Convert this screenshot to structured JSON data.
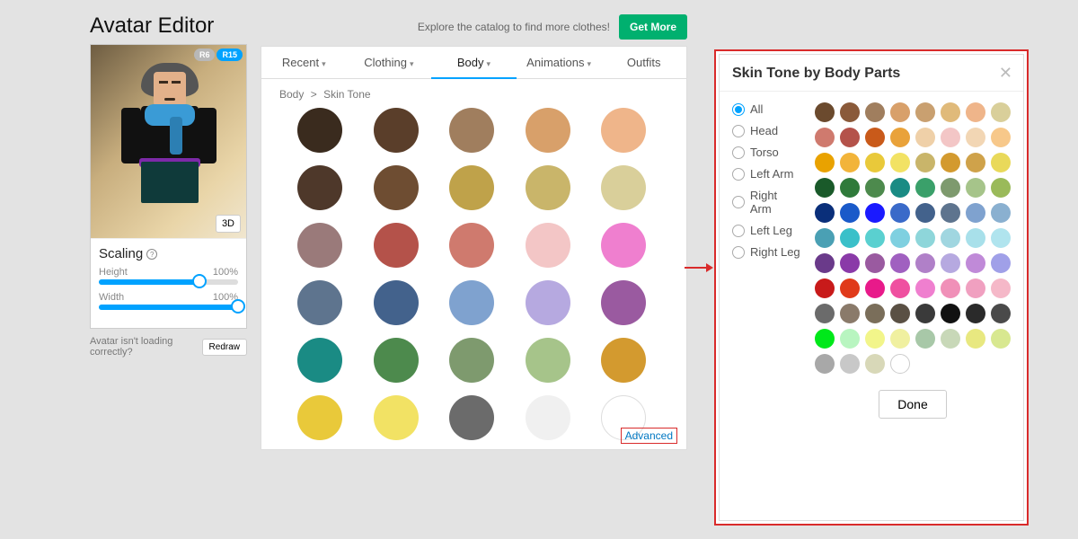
{
  "title": "Avatar Editor",
  "badges": {
    "r6": "R6",
    "r15": "R15"
  },
  "btn_3d": "3D",
  "scaling": {
    "title": "Scaling",
    "height_label": "Height",
    "height_value": "100%",
    "height_pct": 72,
    "width_label": "Width",
    "width_value": "100%",
    "width_pct": 100
  },
  "loading_prompt": "Avatar isn't loading correctly?",
  "redraw_label": "Redraw",
  "promo_text": "Explore the catalog to find more clothes!",
  "get_more_label": "Get More",
  "tabs": {
    "recent": "Recent",
    "clothing": "Clothing",
    "body": "Body",
    "animations": "Animations",
    "outfits": "Outfits"
  },
  "breadcrumb": {
    "a": "Body",
    "sep": ">",
    "b": "Skin Tone"
  },
  "main_swatches": [
    "#3a2b1e",
    "#5a3e2a",
    "#a07e5e",
    "#d8a06a",
    "#efb58a",
    "#4e382a",
    "#6e4d32",
    "#bfa24a",
    "#c9b56a",
    "#d9cf9a",
    "#9a7a7a",
    "#b4524a",
    "#cf7a6e",
    "#f3c6c6",
    "#ef7fcf",
    "#5e748e",
    "#43628c",
    "#7fa2cf",
    "#b6a9e0",
    "#9a5aa0",
    "#1a8b84",
    "#4d8a4d",
    "#7e9a6e",
    "#a6c48a",
    "#d39a2f",
    "#e9c93a",
    "#f2e264",
    "#6b6b6b",
    "#f0f0f0",
    "#ffffff"
  ],
  "advanced_label": "Advanced",
  "dialog": {
    "title": "Skin Tone by Body Parts",
    "parts": [
      "All",
      "Head",
      "Torso",
      "Left Arm",
      "Right Arm",
      "Left Leg",
      "Right Leg"
    ],
    "selected": "All",
    "done_label": "Done",
    "swatches": [
      "#6b4a2e",
      "#8a5a3a",
      "#a07e5e",
      "#d8a06a",
      "#c9a070",
      "#e0ba7a",
      "#efb58a",
      "#d9cf9a",
      "#cf7a6e",
      "#b4524a",
      "#c95a1a",
      "#e9a23a",
      "#efd0a8",
      "#f3c6c6",
      "#f2d6b4",
      "#f7c88a",
      "#e9a200",
      "#f2b43a",
      "#e9c93a",
      "#f2e264",
      "#c9b56a",
      "#d39a2f",
      "#cfa24a",
      "#e9d95a",
      "#1a5a2a",
      "#2f7a3a",
      "#4d8a4d",
      "#1a8b84",
      "#3aa06a",
      "#7e9a6e",
      "#a6c48a",
      "#9aba5a",
      "#0a2f7a",
      "#1a5ac9",
      "#1a1aff",
      "#3a6ac9",
      "#43628c",
      "#5e748e",
      "#7fa2cf",
      "#8ab0d0",
      "#4aa0b4",
      "#3ac0c9",
      "#5ad0d0",
      "#7fd0e0",
      "#8ed6da",
      "#a0d6e0",
      "#a8e0ea",
      "#b0e4ee",
      "#6a3a8a",
      "#8a3aa8",
      "#9a5aa0",
      "#a060c0",
      "#b080c8",
      "#b6a9e0",
      "#c08ad8",
      "#a0a0e8",
      "#c81a1a",
      "#e03a1a",
      "#e81a8a",
      "#ef50a0",
      "#ef7fcf",
      "#f090b8",
      "#f0a0c0",
      "#f5b8c8",
      "#6b6b6b",
      "#8a7a6a",
      "#7a6e5a",
      "#5a5044",
      "#3a3a3a",
      "#111111",
      "#2a2a2a",
      "#4a4a4a",
      "#00e81a",
      "#b8f5c0",
      "#f2f58a",
      "#f0f0a0",
      "#a8c8a8",
      "#c8d8b8",
      "#e8e880",
      "#d8e890",
      "#a8a8a8",
      "#c8c8c8",
      "#d8d8b8",
      "#ffffff"
    ]
  }
}
